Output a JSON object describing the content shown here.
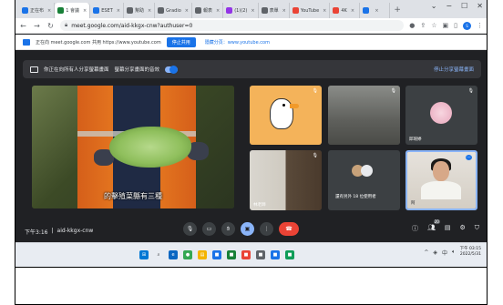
{
  "browser": {
    "tabs": [
      {
        "label": "正在布",
        "color": "#1a73e8",
        "active": false
      },
      {
        "label": "1 會議",
        "color": "#188038",
        "active": true
      },
      {
        "label": "ESET",
        "color": "#1a73e8",
        "active": false
      },
      {
        "label": "幫助",
        "color": "#5f6368",
        "active": false
      },
      {
        "label": "Gradio",
        "color": "#5f6368",
        "active": false
      },
      {
        "label": "報表",
        "color": "#5f6368",
        "active": false
      },
      {
        "label": "(1)(2)",
        "color": "#9334e6",
        "active": false
      },
      {
        "label": "表單",
        "color": "#5f6368",
        "active": false
      },
      {
        "label": "YouTube",
        "color": "#ea4335",
        "active": false
      },
      {
        "label": "4K",
        "color": "#ea4335",
        "active": false
      },
      {
        "label": "",
        "color": "#1a73e8",
        "active": false
      }
    ],
    "new_tab_label": "+",
    "url": "meet.google.com/aid-kkgx-cnw?authuser=0",
    "profile_initial": "S"
  },
  "share_bar": {
    "text": "正在向 meet.google.com 共用 https://www.youtube.com",
    "stop_label": "停止共用",
    "hide_label": "隱藏分頁：www.youtube.com"
  },
  "meet": {
    "present_text": "你正在向所有人分享螢幕畫面",
    "share_audio_label": "螢幕分享畫面的音效",
    "stop_share_label": "停止分享螢幕畫面",
    "main_caption": "的擊殖菜縣有三種",
    "tiles": [
      {
        "name": ""
      },
      {
        "name": ""
      },
      {
        "name": "邱琬婷"
      },
      {
        "name": "林老師"
      },
      {
        "name": "還有另外 18 位使用者"
      },
      {
        "name": "阿"
      }
    ],
    "time": "下午3:16",
    "meeting_code": "aid-kkgx-cnw",
    "participant_count": "20"
  },
  "taskbar": {
    "clock_time": "下午 03:15",
    "clock_date": "2022/5/31",
    "tray_lang": "中"
  },
  "colors": {
    "meet_bg": "#202124",
    "accent": "#1a73e8",
    "leave": "#ea4335"
  }
}
